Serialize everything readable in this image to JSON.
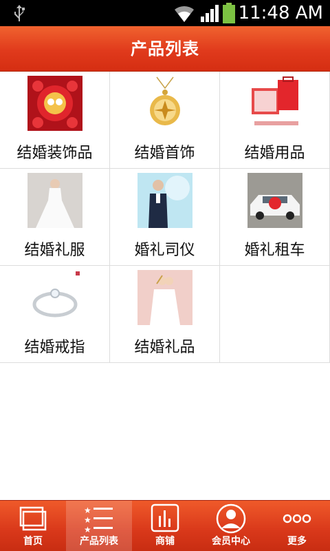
{
  "status_bar": {
    "time": "11:48 AM",
    "icons": [
      "usb-icon",
      "wifi-icon",
      "signal-icon",
      "battery-icon"
    ]
  },
  "header": {
    "title": "产品列表"
  },
  "products": [
    {
      "label": "结婚装饰品",
      "icon": "wedding-decoration-thumbnail"
    },
    {
      "label": "结婚首饰",
      "icon": "wedding-jewelry-thumbnail"
    },
    {
      "label": "结婚用品",
      "icon": "wedding-supplies-thumbnail"
    },
    {
      "label": "结婚礼服",
      "icon": "wedding-dress-thumbnail"
    },
    {
      "label": "婚礼司仪",
      "icon": "wedding-host-thumbnail"
    },
    {
      "label": "婚礼租车",
      "icon": "wedding-car-thumbnail"
    },
    {
      "label": "结婚戒指",
      "icon": "wedding-ring-thumbnail"
    },
    {
      "label": "结婚礼品",
      "icon": "wedding-gift-thumbnail"
    }
  ],
  "bottom_nav": [
    {
      "label": "首页",
      "icon": "home-icon"
    },
    {
      "label": "产品列表",
      "icon": "list-icon",
      "active": true
    },
    {
      "label": "商铺",
      "icon": "shop-icon"
    },
    {
      "label": "会员中心",
      "icon": "user-icon"
    },
    {
      "label": "更多",
      "icon": "more-icon"
    }
  ],
  "colors": {
    "header": "#e03a1c",
    "nav": "#d9381a",
    "divider": "#dcdcdc"
  }
}
